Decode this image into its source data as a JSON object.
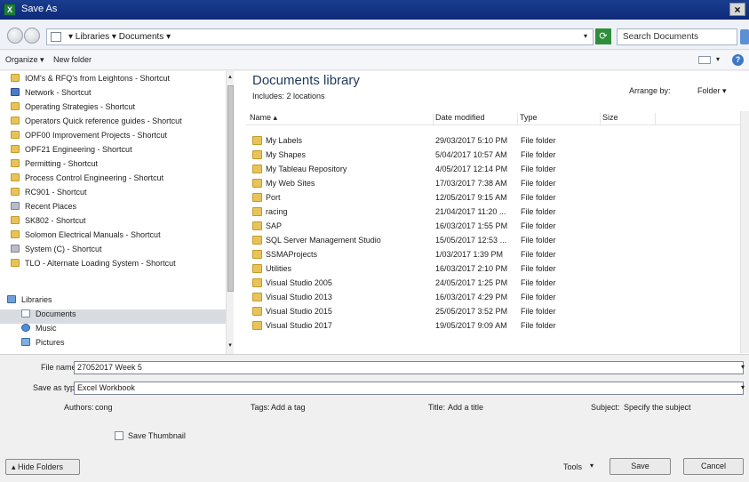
{
  "window": {
    "title": "Save As",
    "close_glyph": "×",
    "app_icon_glyph": "X"
  },
  "address": {
    "breadcrumb": "▾ Libraries ▾ Documents ▾",
    "dropdown_glyph": "▾",
    "search_placeholder": "Search Documents"
  },
  "toolbar": {
    "organize_label": "Organize ▾",
    "new_folder_label": "New folder",
    "views_drop": "▾",
    "help_glyph": "?"
  },
  "nav": {
    "items": [
      {
        "label": "IOM's & RFQ's from Leightons - Shortcut",
        "icon": "folder-icon"
      },
      {
        "label": "Network - Shortcut",
        "icon": "network-icon"
      },
      {
        "label": "Operating Strategies - Shortcut",
        "icon": "folder-icon"
      },
      {
        "label": "Operators Quick reference guides - Shortcut",
        "icon": "folder-icon"
      },
      {
        "label": "OPF00 Improvement Projects - Shortcut",
        "icon": "folder-icon"
      },
      {
        "label": "OPF21 Engineering - Shortcut",
        "icon": "folder-icon"
      },
      {
        "label": "Permitting - Shortcut",
        "icon": "folder-icon"
      },
      {
        "label": "Process Control Engineering - Shortcut",
        "icon": "folder-icon"
      },
      {
        "label": "RC901 - Shortcut",
        "icon": "folder-icon"
      },
      {
        "label": "Recent Places",
        "icon": "recent-places-icon"
      },
      {
        "label": "SK802 - Shortcut",
        "icon": "folder-icon"
      },
      {
        "label": "Solomon Electrical Manuals - Shortcut",
        "icon": "folder-icon"
      },
      {
        "label": "System (C) - Shortcut",
        "icon": "drive-icon"
      },
      {
        "label": "TLO - Alternate Loading System - Shortcut",
        "icon": "folder-icon"
      }
    ],
    "libraries_label": "Libraries",
    "library_items": [
      {
        "label": "Documents",
        "icon": "documents-icon"
      },
      {
        "label": "Music",
        "icon": "music-icon"
      },
      {
        "label": "Pictures",
        "icon": "pictures-icon"
      }
    ]
  },
  "main": {
    "title": "Documents library",
    "subtitle": "Includes: 2 locations",
    "arrange_label": "Arrange by:",
    "arrange_value": "Folder ▾",
    "columns": {
      "name": "Name ▴",
      "date": "Date modified",
      "type": "Type",
      "size": "Size"
    },
    "rows": [
      {
        "name": "My Labels",
        "date": "29/03/2017 5:10 PM",
        "type": "File folder"
      },
      {
        "name": "My Shapes",
        "date": "5/04/2017 10:57 AM",
        "type": "File folder"
      },
      {
        "name": "My Tableau Repository",
        "date": "4/05/2017 12:14 PM",
        "type": "File folder"
      },
      {
        "name": "My Web Sites",
        "date": "17/03/2017 7:38 AM",
        "type": "File folder"
      },
      {
        "name": "Port",
        "date": "12/05/2017 9:15 AM",
        "type": "File folder"
      },
      {
        "name": "racing",
        "date": "21/04/2017 11:20 ...",
        "type": "File folder"
      },
      {
        "name": "SAP",
        "date": "16/03/2017 1:55 PM",
        "type": "File folder"
      },
      {
        "name": "SQL Server Management Studio",
        "date": "15/05/2017 12:53 ...",
        "type": "File folder"
      },
      {
        "name": "SSMAProjects",
        "date": "1/03/2017 1:39 PM",
        "type": "File folder"
      },
      {
        "name": "Utilities",
        "date": "16/03/2017 2:10 PM",
        "type": "File folder"
      },
      {
        "name": "Visual Studio 2005",
        "date": "24/05/2017 1:25 PM",
        "type": "File folder"
      },
      {
        "name": "Visual Studio 2013",
        "date": "16/03/2017 4:29 PM",
        "type": "File folder"
      },
      {
        "name": "Visual Studio 2015",
        "date": "25/05/2017 3:52 PM",
        "type": "File folder"
      },
      {
        "name": "Visual Studio 2017",
        "date": "19/05/2017 9:09 AM",
        "type": "File folder"
      }
    ]
  },
  "form": {
    "file_name_label": "File name:",
    "file_name_value": "27052017 Week 5",
    "save_as_type_label": "Save as type:",
    "save_as_type_value": "Excel Workbook",
    "dropdown_glyph": "▾",
    "authors_label": "Authors:",
    "authors_value": "cong",
    "tags_label": "Tags:",
    "tags_value": "Add a tag",
    "title_label": "Title:",
    "title_value": "Add a title",
    "subject_label": "Subject:",
    "subject_value": "Specify the subject",
    "save_thumbnail_label": "Save Thumbnail"
  },
  "buttons": {
    "hide_folders": "▴ Hide Folders",
    "tools": "Tools",
    "tools_drop": "▾",
    "save": "Save",
    "cancel": "Cancel"
  },
  "scroll": {
    "up": "▴",
    "down": "▾"
  }
}
